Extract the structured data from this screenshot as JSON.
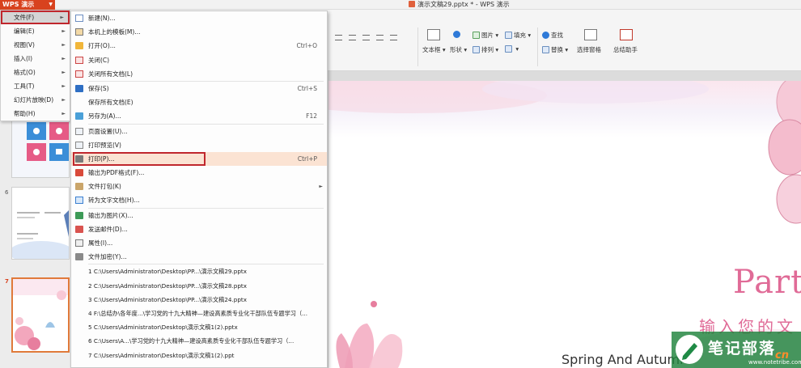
{
  "app": {
    "title": "演示文稿29.pptx * - WPS 演示",
    "brand_label": "WPS 演示"
  },
  "ribbon": {
    "items": [
      {
        "label": "查找"
      },
      {
        "label": "替换"
      },
      {
        "label": "选择窗格"
      },
      {
        "label": "总结助手"
      },
      {
        "label": "文本框"
      },
      {
        "label": "形状"
      },
      {
        "label": "排列"
      },
      {
        "label": "图片"
      },
      {
        "label": "填充"
      }
    ]
  },
  "main_menu": {
    "items": [
      {
        "label": "文件(F)",
        "has_submenu": true,
        "active": true
      },
      {
        "label": "编辑(E)",
        "has_submenu": true
      },
      {
        "label": "视图(V)",
        "has_submenu": true
      },
      {
        "label": "插入(I)",
        "has_submenu": true
      },
      {
        "label": "格式(O)",
        "has_submenu": true
      },
      {
        "label": "工具(T)",
        "has_submenu": true
      },
      {
        "label": "幻灯片放映(D)",
        "has_submenu": true
      },
      {
        "label": "帮助(H)",
        "has_submenu": true
      }
    ]
  },
  "file_menu": {
    "items": [
      {
        "label": "新建(N)...",
        "shortcut": "",
        "icon": "new-doc-icon"
      },
      {
        "label": "本机上的模板(M)...",
        "shortcut": "",
        "icon": "template-icon"
      },
      {
        "label": "打开(O)...",
        "shortcut": "Ctrl+O",
        "icon": "folder-open-icon"
      },
      {
        "label": "关闭(C)",
        "shortcut": "",
        "icon": "close-doc-icon"
      },
      {
        "label": "关闭所有文档(L)",
        "shortcut": "",
        "icon": "close-all-icon"
      },
      {
        "label": "保存(S)",
        "shortcut": "Ctrl+S",
        "icon": "save-icon"
      },
      {
        "label": "保存所有文档(E)",
        "shortcut": "",
        "icon": ""
      },
      {
        "label": "另存为(A)...",
        "shortcut": "F12",
        "icon": "save-as-icon"
      },
      {
        "label": "页面设置(U)...",
        "shortcut": "",
        "icon": "page-setup-icon"
      },
      {
        "label": "打印预览(V)",
        "shortcut": "",
        "icon": "print-preview-icon"
      },
      {
        "label": "打印(P)...",
        "shortcut": "Ctrl+P",
        "icon": "print-icon",
        "highlighted": true
      },
      {
        "label": "输出为PDF格式(F)...",
        "shortcut": "",
        "icon": "pdf-icon"
      },
      {
        "label": "文件打包(K)",
        "shortcut": "",
        "icon": "package-icon",
        "has_submenu": true
      },
      {
        "label": "转为文字文档(H)...",
        "shortcut": "",
        "icon": "to-text-icon"
      },
      {
        "label": "输出为图片(X)...",
        "shortcut": "",
        "icon": "export-image-icon"
      },
      {
        "label": "发送邮件(D)...",
        "shortcut": "",
        "icon": "mail-icon"
      },
      {
        "label": "属性(I)...",
        "shortcut": "",
        "icon": "properties-icon"
      },
      {
        "label": "文件加密(Y)...",
        "shortcut": "",
        "icon": "lock-icon"
      }
    ],
    "recent": [
      "1 C:\\Users\\Administrator\\Desktop\\PP...\\演示文稿29.pptx",
      "2 C:\\Users\\Administrator\\Desktop\\PP...\\演示文稿28.pptx",
      "3 C:\\Users\\Administrator\\Desktop\\PP...\\演示文稿24.pptx",
      "4 F:\\总结办\\各年度...\\学习党的十九大精神—建设高素质专业化干部队伍专题学习（...",
      "5 C:\\Users\\Administrator\\Desktop\\演示文稿1(2).pptx",
      "6 C:\\Users\\A...\\学习党的十九大精神—建设高素质专业化干部队伍专题学习（...",
      "7 C:\\Users\\Administrator\\Desktop\\演示文稿1(2).ppt"
    ]
  },
  "slides_panel": {
    "numbers": [
      "6",
      "7"
    ]
  },
  "slide": {
    "title": "Part",
    "subtitle_cn": "输入您的文",
    "caption": "Spring And Autumn"
  },
  "watermark": {
    "main": "笔记部落",
    "sub": "www.notetribe.com",
    "cn": "cn"
  },
  "colors": {
    "brand": "#d8421e",
    "highlight_box": "#c0272d",
    "slide_accent": "#e06b97"
  }
}
